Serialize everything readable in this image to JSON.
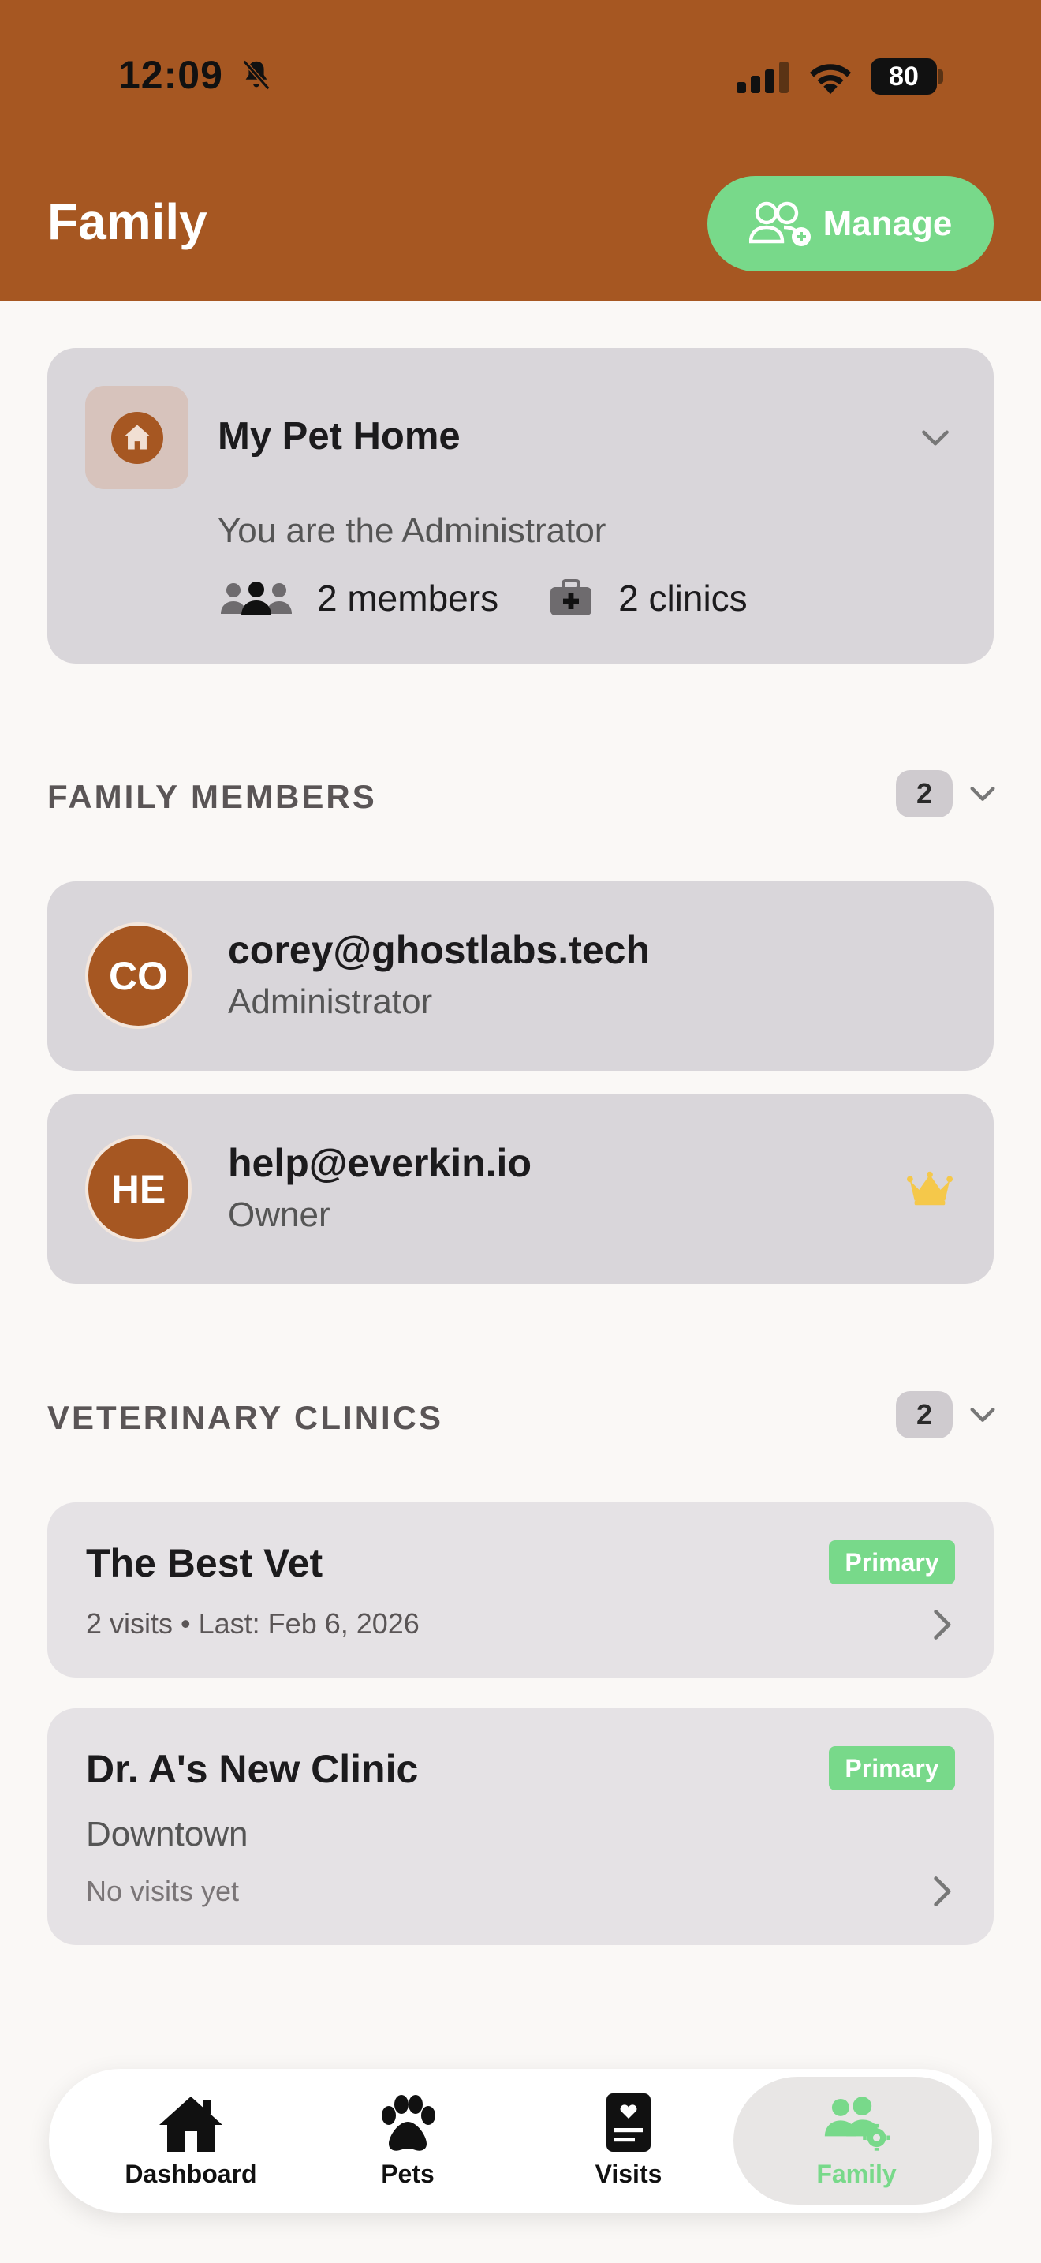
{
  "status_bar": {
    "time": "12:09",
    "battery": "80"
  },
  "header": {
    "title": "Family",
    "manage_label": "Manage"
  },
  "home": {
    "name": "My Pet Home",
    "role_text": "You are the Administrator",
    "members_text": "2 members",
    "clinics_text": "2 clinics"
  },
  "family_members": {
    "title": "FAMILY MEMBERS",
    "count": "2",
    "items": [
      {
        "initials": "CO",
        "email": "corey@ghostlabs.tech",
        "role": "Administrator"
      },
      {
        "initials": "HE",
        "email": "help@everkin.io",
        "role": "Owner",
        "icon": "crown-icon"
      }
    ]
  },
  "veterinary_clinics": {
    "title": "VETERINARY CLINICS",
    "count": "2",
    "items": [
      {
        "name": "The Best Vet",
        "badge": "Primary",
        "meta": "2 visits • Last: Feb 6, 2026"
      },
      {
        "name": "Dr. A's New Clinic",
        "badge": "Primary",
        "location": "Downtown",
        "meta": "No visits yet"
      }
    ]
  },
  "tabbar": {
    "items": [
      {
        "label": "Dashboard",
        "icon": "house-icon"
      },
      {
        "label": "Pets",
        "icon": "paw-icon"
      },
      {
        "label": "Visits",
        "icon": "medical-record-icon"
      },
      {
        "label": "Family",
        "icon": "family-settings-icon",
        "active": true
      }
    ]
  },
  "colors": {
    "brand": "#a65722",
    "accent_green": "#78d98a",
    "card": "#d9d6da",
    "background": "#faf8f6"
  }
}
